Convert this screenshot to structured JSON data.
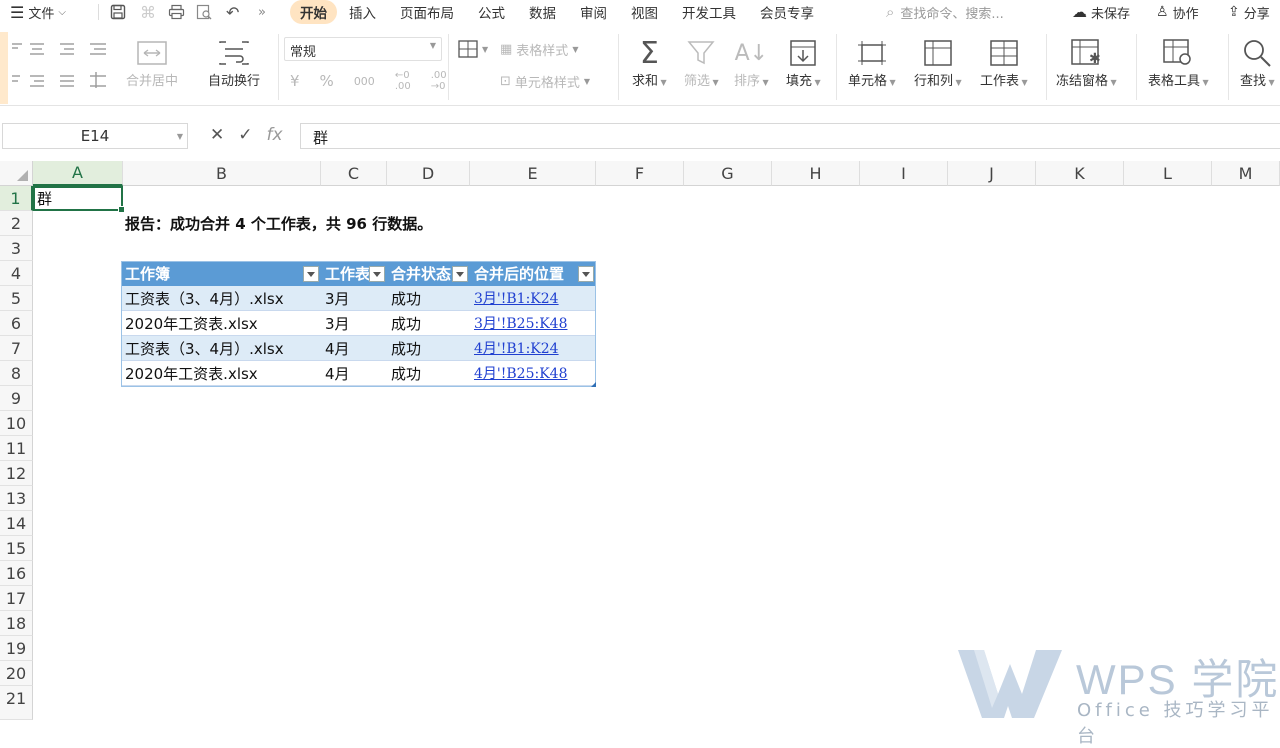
{
  "menubar": {
    "file_label": "文件",
    "tabs": [
      "开始",
      "插入",
      "页面布局",
      "公式",
      "数据",
      "审阅",
      "视图",
      "开发工具",
      "会员专享"
    ],
    "search_placeholder": "查找命令、搜索...",
    "unsaved_label": "未保存",
    "collab_label": "协作",
    "share_label": "分享"
  },
  "ribbon": {
    "merge_label": "合并居中",
    "autowrap_label": "自动换行",
    "number_format": "常规",
    "table_style_label": "表格样式",
    "cell_style_label": "单元格样式",
    "sum_label": "求和",
    "filter_label": "筛选",
    "sort_label": "排序",
    "fill_label": "填充",
    "cell_label": "单元格",
    "rowcol_label": "行和列",
    "sheet_label": "工作表",
    "freeze_label": "冻结窗格",
    "tabletools_label": "表格工具",
    "find_label": "查找"
  },
  "formula_bar": {
    "name_box": "E14",
    "value": "群"
  },
  "grid": {
    "columns": [
      "A",
      "B",
      "C",
      "D",
      "E",
      "F",
      "G",
      "H",
      "I",
      "J",
      "K",
      "L",
      "M"
    ],
    "rows": [
      "1",
      "2",
      "3",
      "4",
      "5",
      "6",
      "7",
      "8",
      "9",
      "10",
      "11",
      "12",
      "13",
      "14",
      "15",
      "16",
      "17",
      "18",
      "19",
      "20",
      "21"
    ],
    "a1": "群",
    "report": "报告：成功合并 4 个工作表，共 96 行数据。"
  },
  "table": {
    "headers": [
      "工作簿",
      "工作表",
      "合并状态",
      "合并后的位置"
    ],
    "rows": [
      [
        "工资表（3、4月）.xlsx",
        "3月",
        "成功",
        "3月'!B1:K24"
      ],
      [
        "2020年工资表.xlsx",
        "3月",
        "成功",
        "3月'!B25:K48"
      ],
      [
        "工资表（3、4月）.xlsx",
        "4月",
        "成功",
        "4月'!B1:K24"
      ],
      [
        "2020年工资表.xlsx",
        "4月",
        "成功",
        "4月'!B25:K48"
      ]
    ]
  },
  "watermark": {
    "title": "WPS 学院",
    "subtitle": "Office 技巧学习平台"
  }
}
